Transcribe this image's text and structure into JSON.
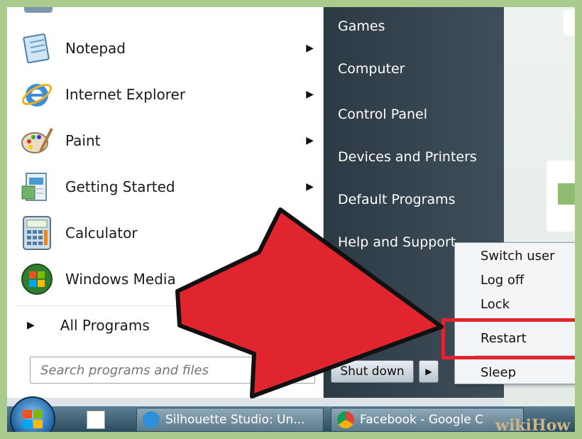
{
  "programs": [
    {
      "label": "Notepad",
      "icon": "notepad-icon",
      "has_submenu": true
    },
    {
      "label": "Internet Explorer",
      "icon": "internet-explorer-icon",
      "has_submenu": true
    },
    {
      "label": "Paint",
      "icon": "paint-icon",
      "has_submenu": true
    },
    {
      "label": "Getting Started",
      "icon": "getting-started-icon",
      "has_submenu": true
    },
    {
      "label": "Calculator",
      "icon": "calculator-icon",
      "has_submenu": false
    },
    {
      "label": "Windows Media",
      "icon": "windows-media-icon",
      "has_submenu": false
    }
  ],
  "all_programs_label": "All Programs",
  "search": {
    "placeholder": "Search programs and files"
  },
  "right_items": [
    "Games",
    "Computer",
    "Control Panel",
    "Devices and Printers",
    "Default Programs",
    "Help and Support"
  ],
  "shutdown_label": "Shut down",
  "power_menu": [
    "Switch user",
    "Log off",
    "Lock",
    "Restart",
    "Sleep"
  ],
  "highlighted_item": "Restart",
  "taskbar": {
    "tasks": [
      {
        "label": "Silhouette Studio: Un...",
        "icon": "silhouette-icon"
      },
      {
        "label": "Facebook - Google C",
        "icon": "chrome-icon"
      }
    ]
  },
  "watermark": "wikiHow",
  "colors": {
    "highlight_border": "#e0252f",
    "arrow": "#e0252f",
    "right_pane": "#2c3a44"
  }
}
